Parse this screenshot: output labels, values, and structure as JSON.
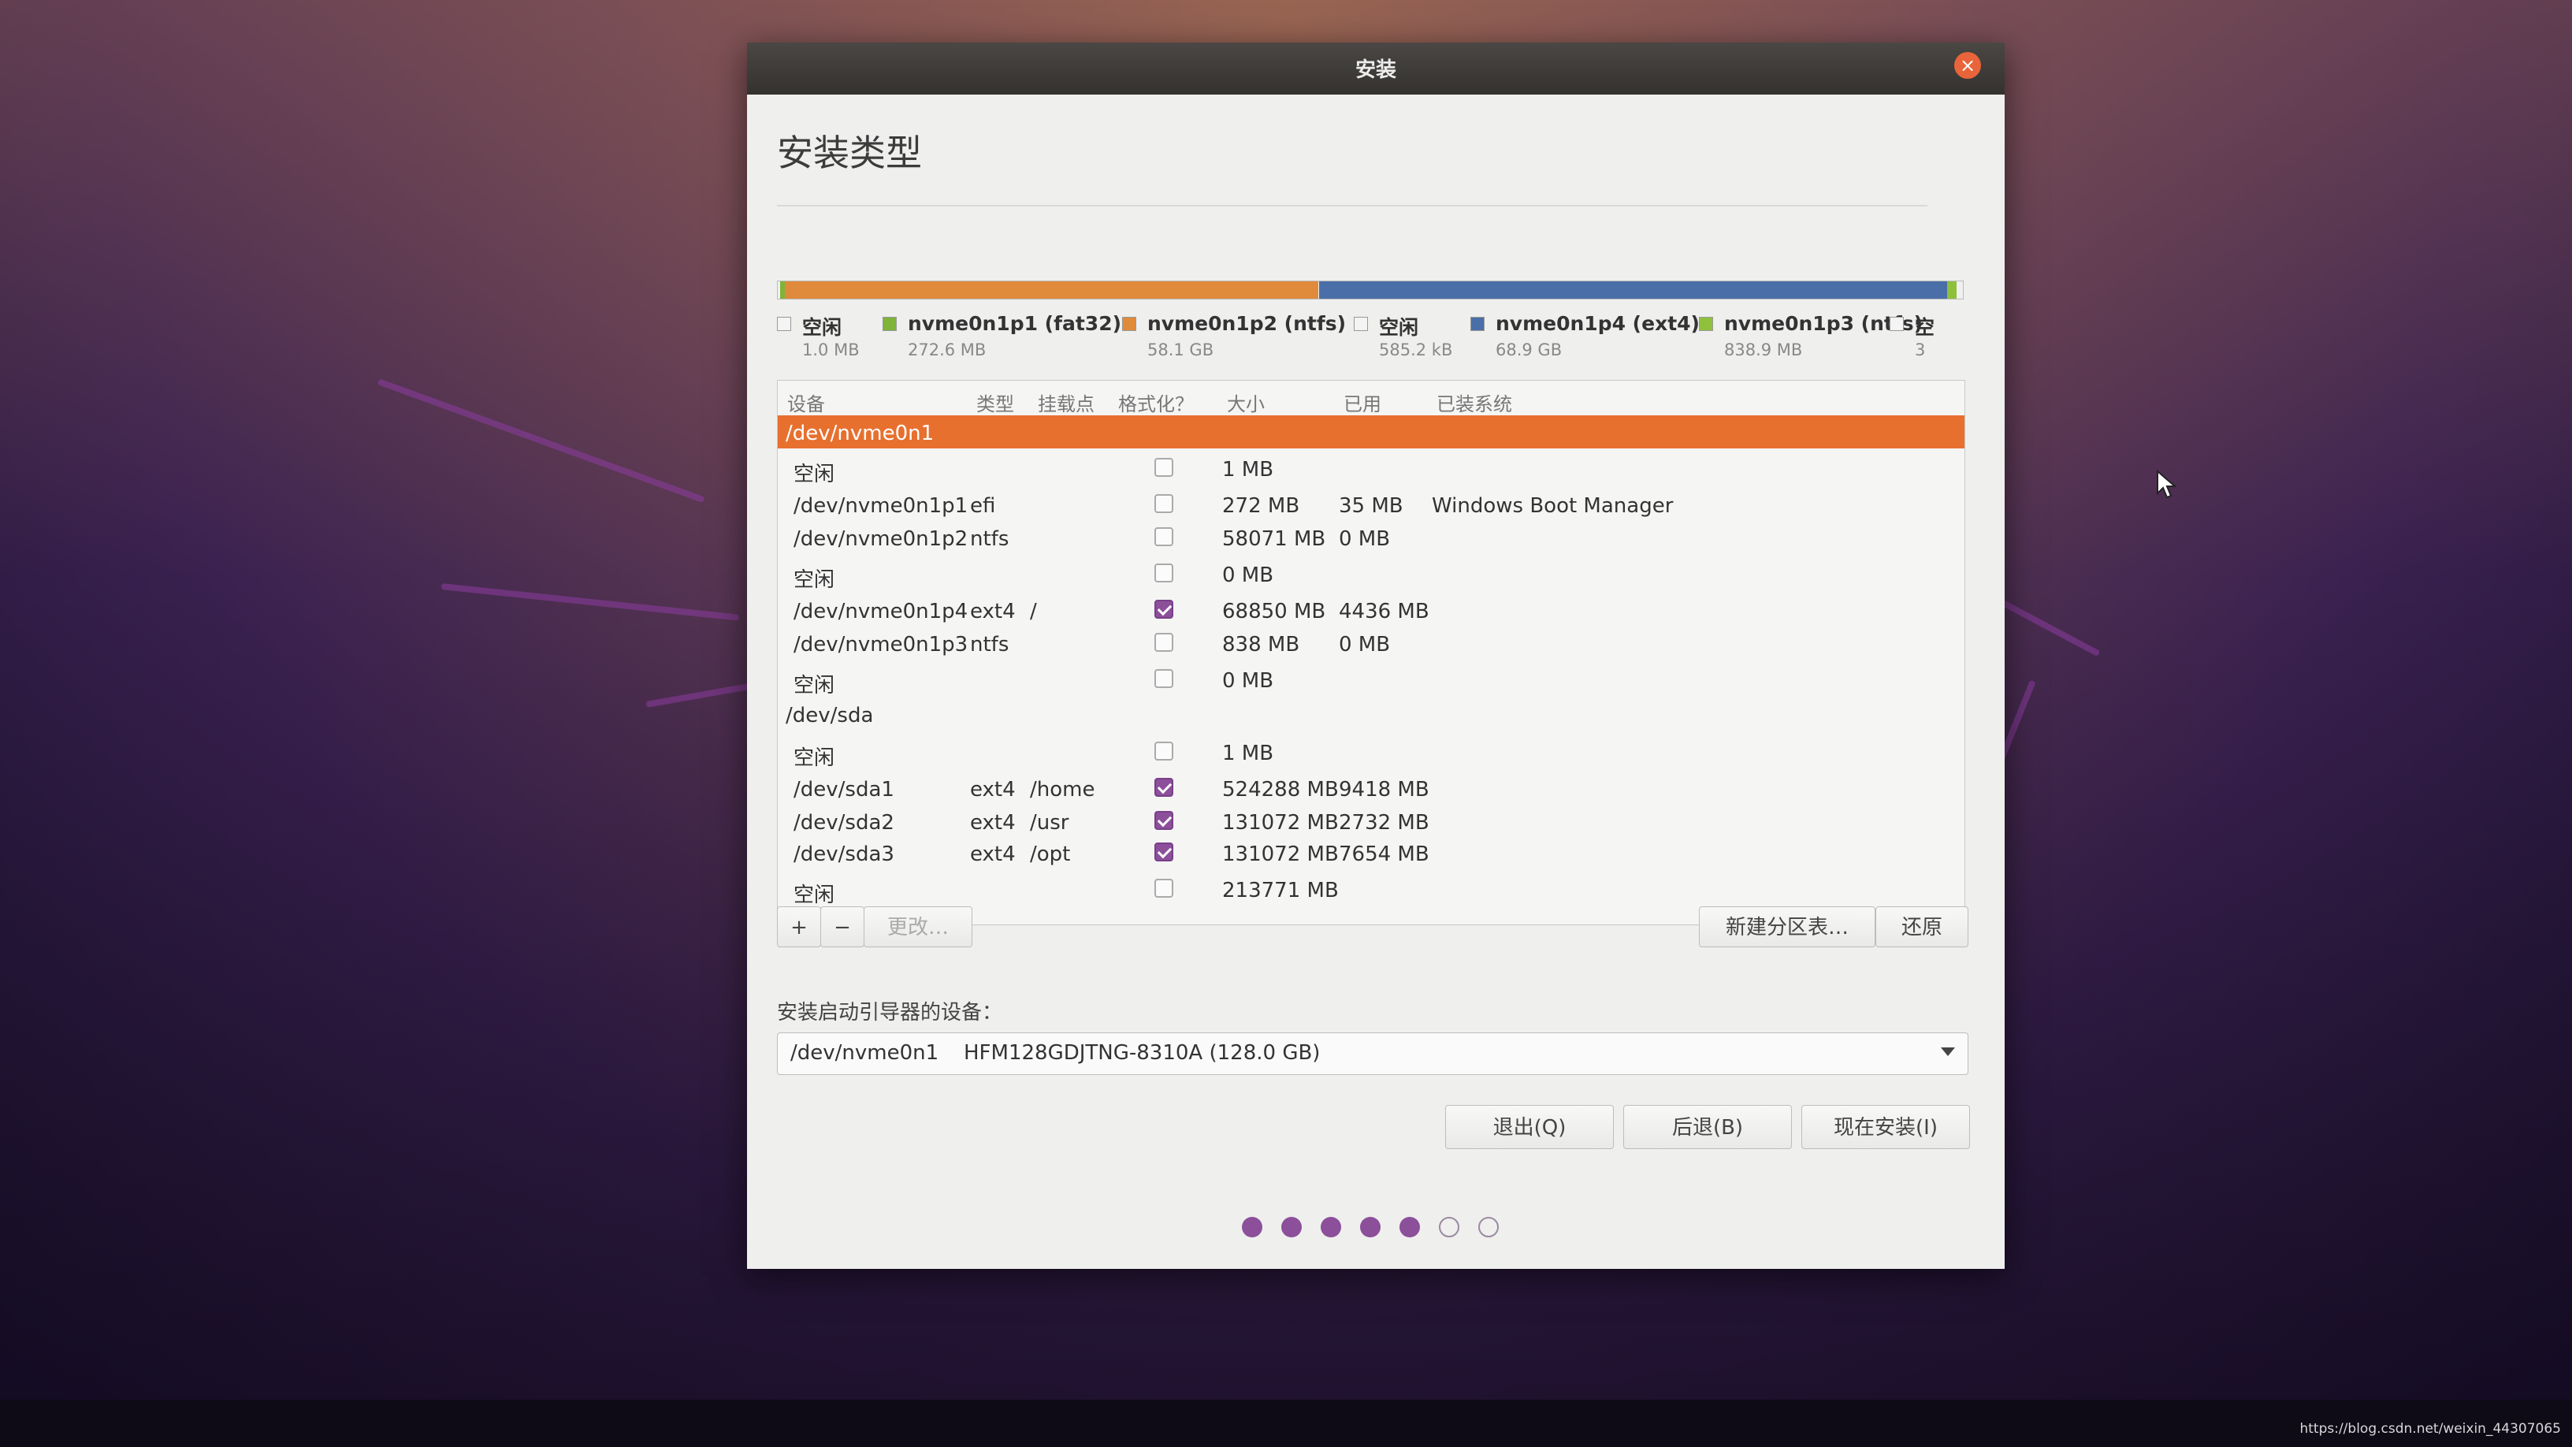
{
  "window": {
    "title": "安装",
    "page_title": "安装类型"
  },
  "partition_bar": {
    "segments": [
      {
        "color": "#f0f0f0",
        "fraction": 0.002
      },
      {
        "color": "#7fb33a",
        "fraction": 0.004
      },
      {
        "color": "#e08a3c",
        "fraction": 0.45
      },
      {
        "color": "#f0f0f0",
        "fraction": 0.001
      },
      {
        "color": "#4a6fa8",
        "fraction": 0.53
      },
      {
        "color": "#8fc03c",
        "fraction": 0.008
      },
      {
        "color": "#f0f0f0",
        "fraction": 0.005
      }
    ]
  },
  "legend": [
    {
      "name": "空闲",
      "size": "1.0 MB",
      "color": "#f4f4f4"
    },
    {
      "name": "nvme0n1p1 (fat32)",
      "size": "272.6 MB",
      "color": "#7fb33a"
    },
    {
      "name": "nvme0n1p2 (ntfs)",
      "size": "58.1 GB",
      "color": "#e08a3c"
    },
    {
      "name": "空闲",
      "size": "585.2 kB",
      "color": "#f4f4f4"
    },
    {
      "name": "nvme0n1p4 (ext4)",
      "size": "68.9 GB",
      "color": "#4a6fa8"
    },
    {
      "name": "nvme0n1p3 (ntfs)",
      "size": "838.9 MB",
      "color": "#8fc03c"
    },
    {
      "name": "空",
      "size": "3",
      "color": "#f4f4f4"
    }
  ],
  "table": {
    "headers": [
      "设备",
      "类型",
      "挂载点",
      "格式化？",
      "大小",
      "已用",
      "已装系统"
    ],
    "rows": [
      {
        "kind": "device",
        "device": "/dev/nvme0n1",
        "selected": true
      },
      {
        "kind": "part",
        "device": "空闲",
        "type": "",
        "mount": "",
        "format": false,
        "size": "1 MB",
        "used": "",
        "system": ""
      },
      {
        "kind": "part",
        "device": "/dev/nvme0n1p1",
        "type": "efi",
        "mount": "",
        "format": false,
        "size": "272 MB",
        "used": "35 MB",
        "system": "Windows Boot Manager"
      },
      {
        "kind": "part",
        "device": "/dev/nvme0n1p2",
        "type": "ntfs",
        "mount": "",
        "format": false,
        "size": "58071 MB",
        "used": "0 MB",
        "system": ""
      },
      {
        "kind": "part",
        "device": "空闲",
        "type": "",
        "mount": "",
        "format": false,
        "size": "0 MB",
        "used": "",
        "system": ""
      },
      {
        "kind": "part",
        "device": "/dev/nvme0n1p4",
        "type": "ext4",
        "mount": "/",
        "format": true,
        "size": "68850 MB",
        "used": "4436 MB",
        "system": ""
      },
      {
        "kind": "part",
        "device": "/dev/nvme0n1p3",
        "type": "ntfs",
        "mount": "",
        "format": false,
        "size": "838 MB",
        "used": "0 MB",
        "system": ""
      },
      {
        "kind": "part",
        "device": "空闲",
        "type": "",
        "mount": "",
        "format": false,
        "size": "0 MB",
        "used": "",
        "system": ""
      },
      {
        "kind": "device",
        "device": "/dev/sda",
        "selected": false
      },
      {
        "kind": "part",
        "device": "空闲",
        "type": "",
        "mount": "",
        "format": false,
        "size": "1 MB",
        "used": "",
        "system": ""
      },
      {
        "kind": "part",
        "device": "/dev/sda1",
        "type": "ext4",
        "mount": "/home",
        "format": true,
        "size": "524288 MB",
        "used": "9418 MB",
        "system": ""
      },
      {
        "kind": "part",
        "device": "/dev/sda2",
        "type": "ext4",
        "mount": "/usr",
        "format": true,
        "size": "131072 MB",
        "used": "2732 MB",
        "system": ""
      },
      {
        "kind": "part",
        "device": "/dev/sda3",
        "type": "ext4",
        "mount": "/opt",
        "format": true,
        "size": "131072 MB",
        "used": "7654 MB",
        "system": ""
      },
      {
        "kind": "part",
        "device": "空闲",
        "type": "",
        "mount": "",
        "format": false,
        "size": "213771 MB",
        "used": "",
        "system": ""
      }
    ]
  },
  "toolbar": {
    "add": "+",
    "remove": "−",
    "change": "更改…",
    "new_table": "新建分区表…",
    "revert": "还原"
  },
  "bootloader": {
    "label": "安装启动引导器的设备：",
    "device": "/dev/nvme0n1",
    "model": "HFM128GDJTNG-8310A (128.0 GB)"
  },
  "actions": {
    "quit": "退出(Q)",
    "back": "后退(B)",
    "install": "现在安装(I)"
  },
  "progress": {
    "total_steps": 7,
    "completed_steps": 5
  },
  "watermark": "https://blog.csdn.net/weixin_44307065",
  "colors": {
    "selected_row": "#e7702f",
    "checkbox_accent": "#8c4f9a",
    "close_button": "#e9643a"
  }
}
